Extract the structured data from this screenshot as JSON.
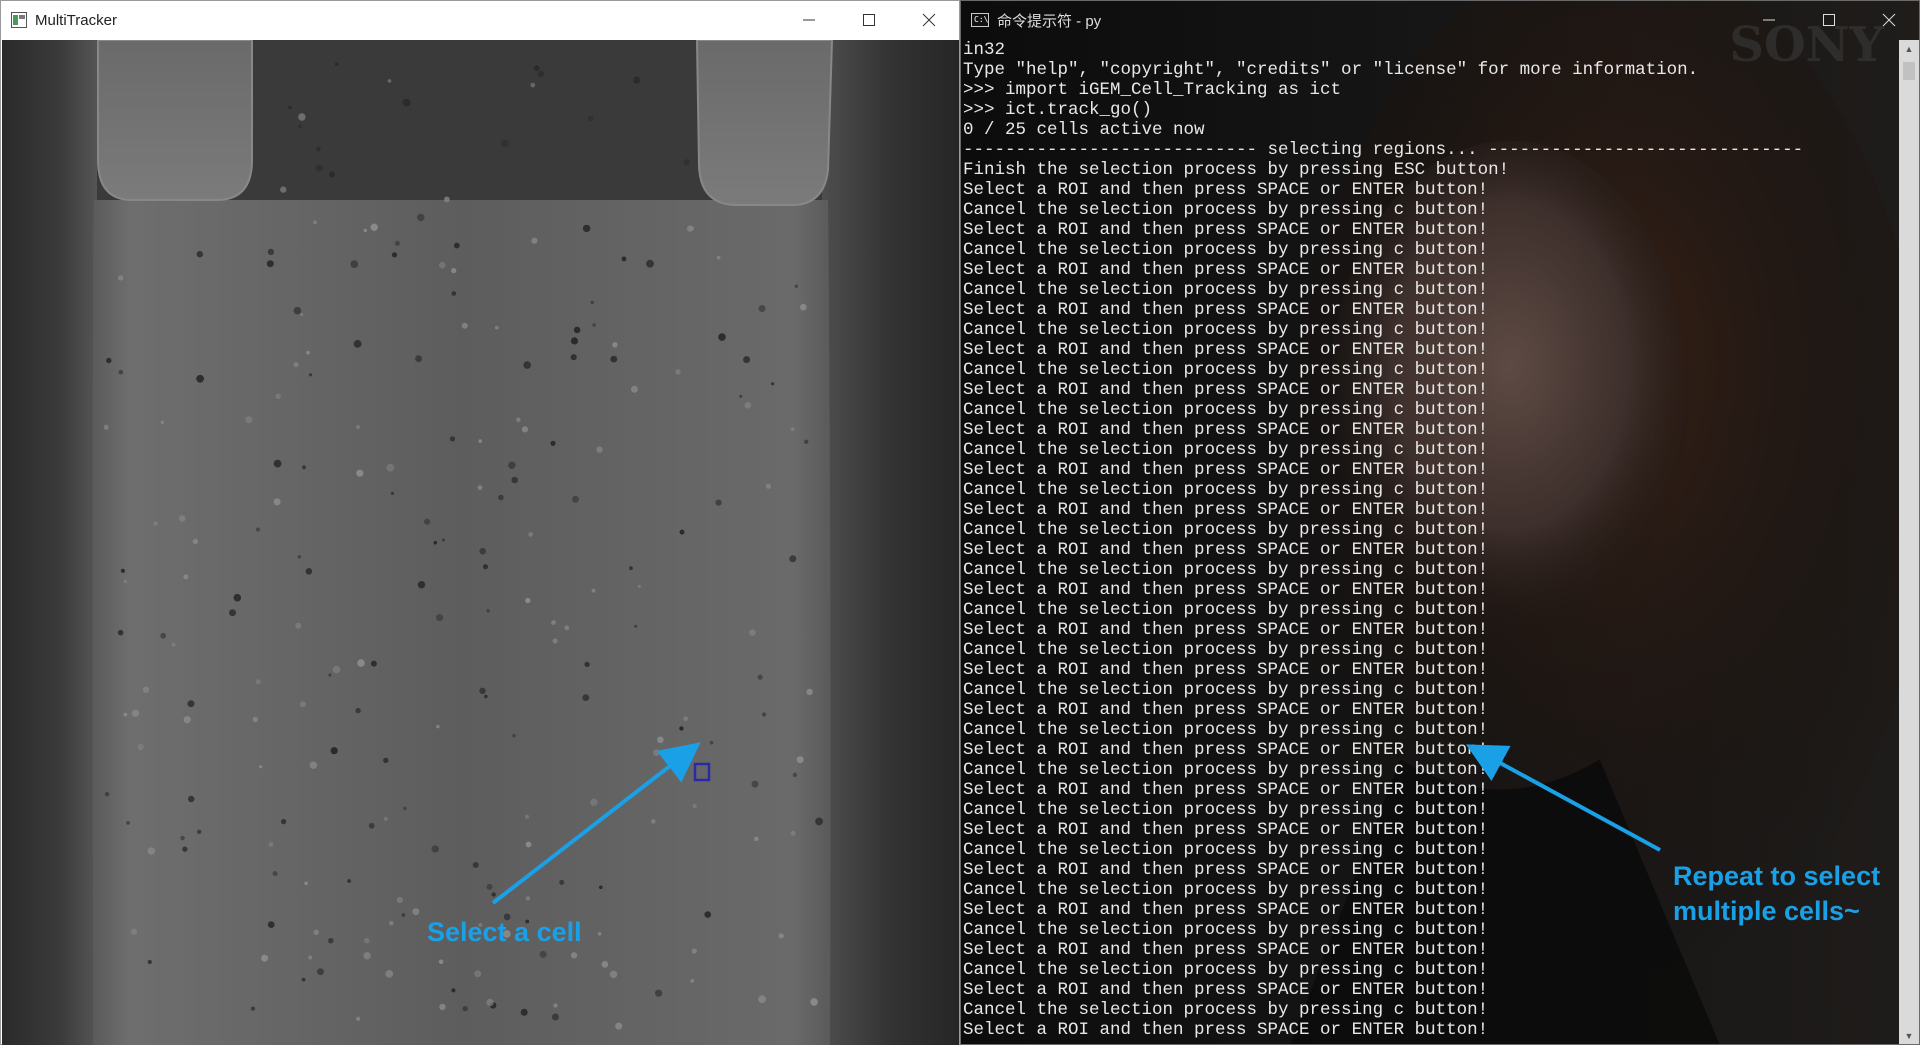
{
  "left_window": {
    "title": "MultiTracker",
    "controls": [
      "minimize",
      "maximize",
      "close"
    ]
  },
  "right_window": {
    "title": "命令提示符 - py",
    "icon_label": "C:\\",
    "background_watermark": "SONY",
    "console_lines": [
      "in32",
      "Type \"help\", \"copyright\", \"credits\" or \"license\" for more information.",
      ">>> import iGEM_Cell_Tracking as ict",
      ">>> ict.track_go()",
      "0 / 25 cells active now",
      "---------------------------- selecting regions... ------------------------------",
      "Finish the selection process by pressing ESC button!",
      "Select a ROI and then press SPACE or ENTER button!",
      "Cancel the selection process by pressing c button!",
      "Select a ROI and then press SPACE or ENTER button!",
      "Cancel the selection process by pressing c button!",
      "Select a ROI and then press SPACE or ENTER button!",
      "Cancel the selection process by pressing c button!",
      "Select a ROI and then press SPACE or ENTER button!",
      "Cancel the selection process by pressing c button!",
      "Select a ROI and then press SPACE or ENTER button!",
      "Cancel the selection process by pressing c button!",
      "Select a ROI and then press SPACE or ENTER button!",
      "Cancel the selection process by pressing c button!",
      "Select a ROI and then press SPACE or ENTER button!",
      "Cancel the selection process by pressing c button!",
      "Select a ROI and then press SPACE or ENTER button!",
      "Cancel the selection process by pressing c button!",
      "Select a ROI and then press SPACE or ENTER button!",
      "Cancel the selection process by pressing c button!",
      "Select a ROI and then press SPACE or ENTER button!",
      "Cancel the selection process by pressing c button!",
      "Select a ROI and then press SPACE or ENTER button!",
      "Cancel the selection process by pressing c button!",
      "Select a ROI and then press SPACE or ENTER button!",
      "Cancel the selection process by pressing c button!",
      "Select a ROI and then press SPACE or ENTER button!",
      "Cancel the selection process by pressing c button!",
      "Select a ROI and then press SPACE or ENTER button!",
      "Cancel the selection process by pressing c button!",
      "Select a ROI and then press SPACE or ENTER button!",
      "Cancel the selection process by pressing c button!",
      "Select a ROI and then press SPACE or ENTER button!",
      "Cancel the selection process by pressing c button!",
      "Select a ROI and then press SPACE or ENTER button!",
      "Cancel the selection process by pressing c button!",
      "Select a ROI and then press SPACE or ENTER button!",
      "Cancel the selection process by pressing c button!",
      "Select a ROI and then press SPACE or ENTER button!",
      "Cancel the selection process by pressing c button!",
      "Select a ROI and then press SPACE or ENTER button!",
      "Cancel the selection process by pressing c button!",
      "Select a ROI and then press SPACE or ENTER button!",
      "Cancel the selection process by pressing c button!",
      "Select a ROI and then press SPACE or ENTER button!"
    ]
  },
  "annotations": {
    "left": "Select a cell",
    "right_line1": "Repeat to select",
    "right_line2": "multiple cells~"
  },
  "colors": {
    "annotation": "#1aa0e6",
    "roi_box": "#2a2aa8",
    "console_text": "#e8e8e8"
  }
}
